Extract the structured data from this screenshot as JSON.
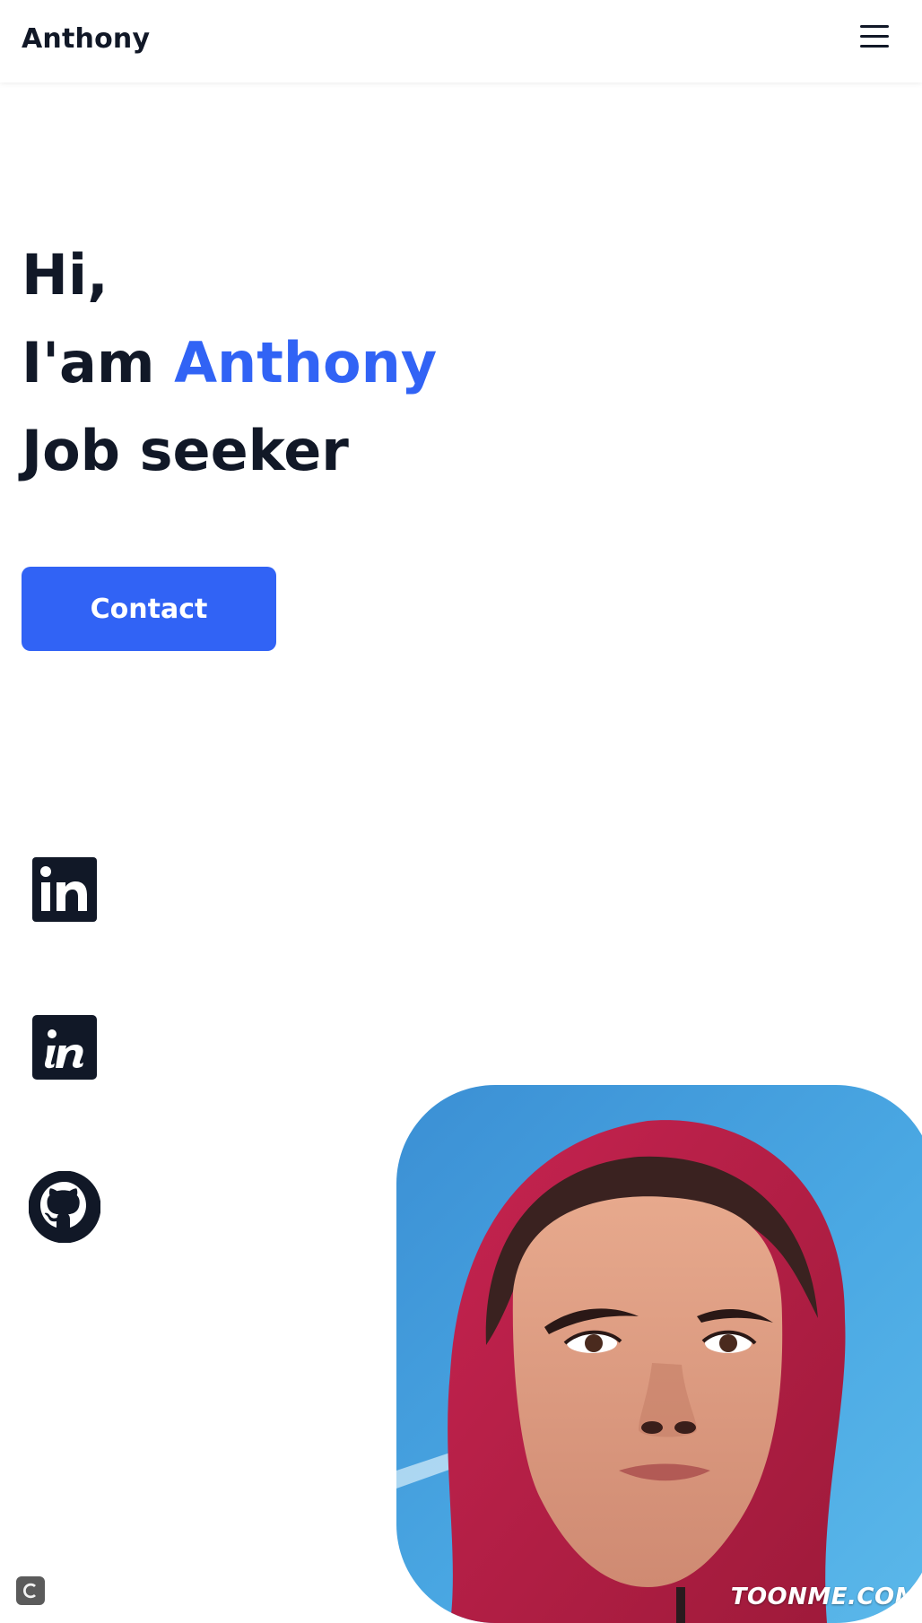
{
  "header": {
    "logo": "Anthony",
    "menu_icon": "hamburger-menu-icon"
  },
  "hero": {
    "line1": "Hi,",
    "line2_prefix": "I'am ",
    "line2_name": "Anthony",
    "line3": "Job seeker",
    "contact_label": "Contact"
  },
  "social": [
    {
      "icon": "linkedin-icon"
    },
    {
      "icon": "invision-icon"
    },
    {
      "icon": "github-icon"
    }
  ],
  "portrait": {
    "watermark": "TOONME.COM"
  },
  "colors": {
    "accent": "#3163f5",
    "text": "#111827",
    "background": "#ffffff"
  }
}
